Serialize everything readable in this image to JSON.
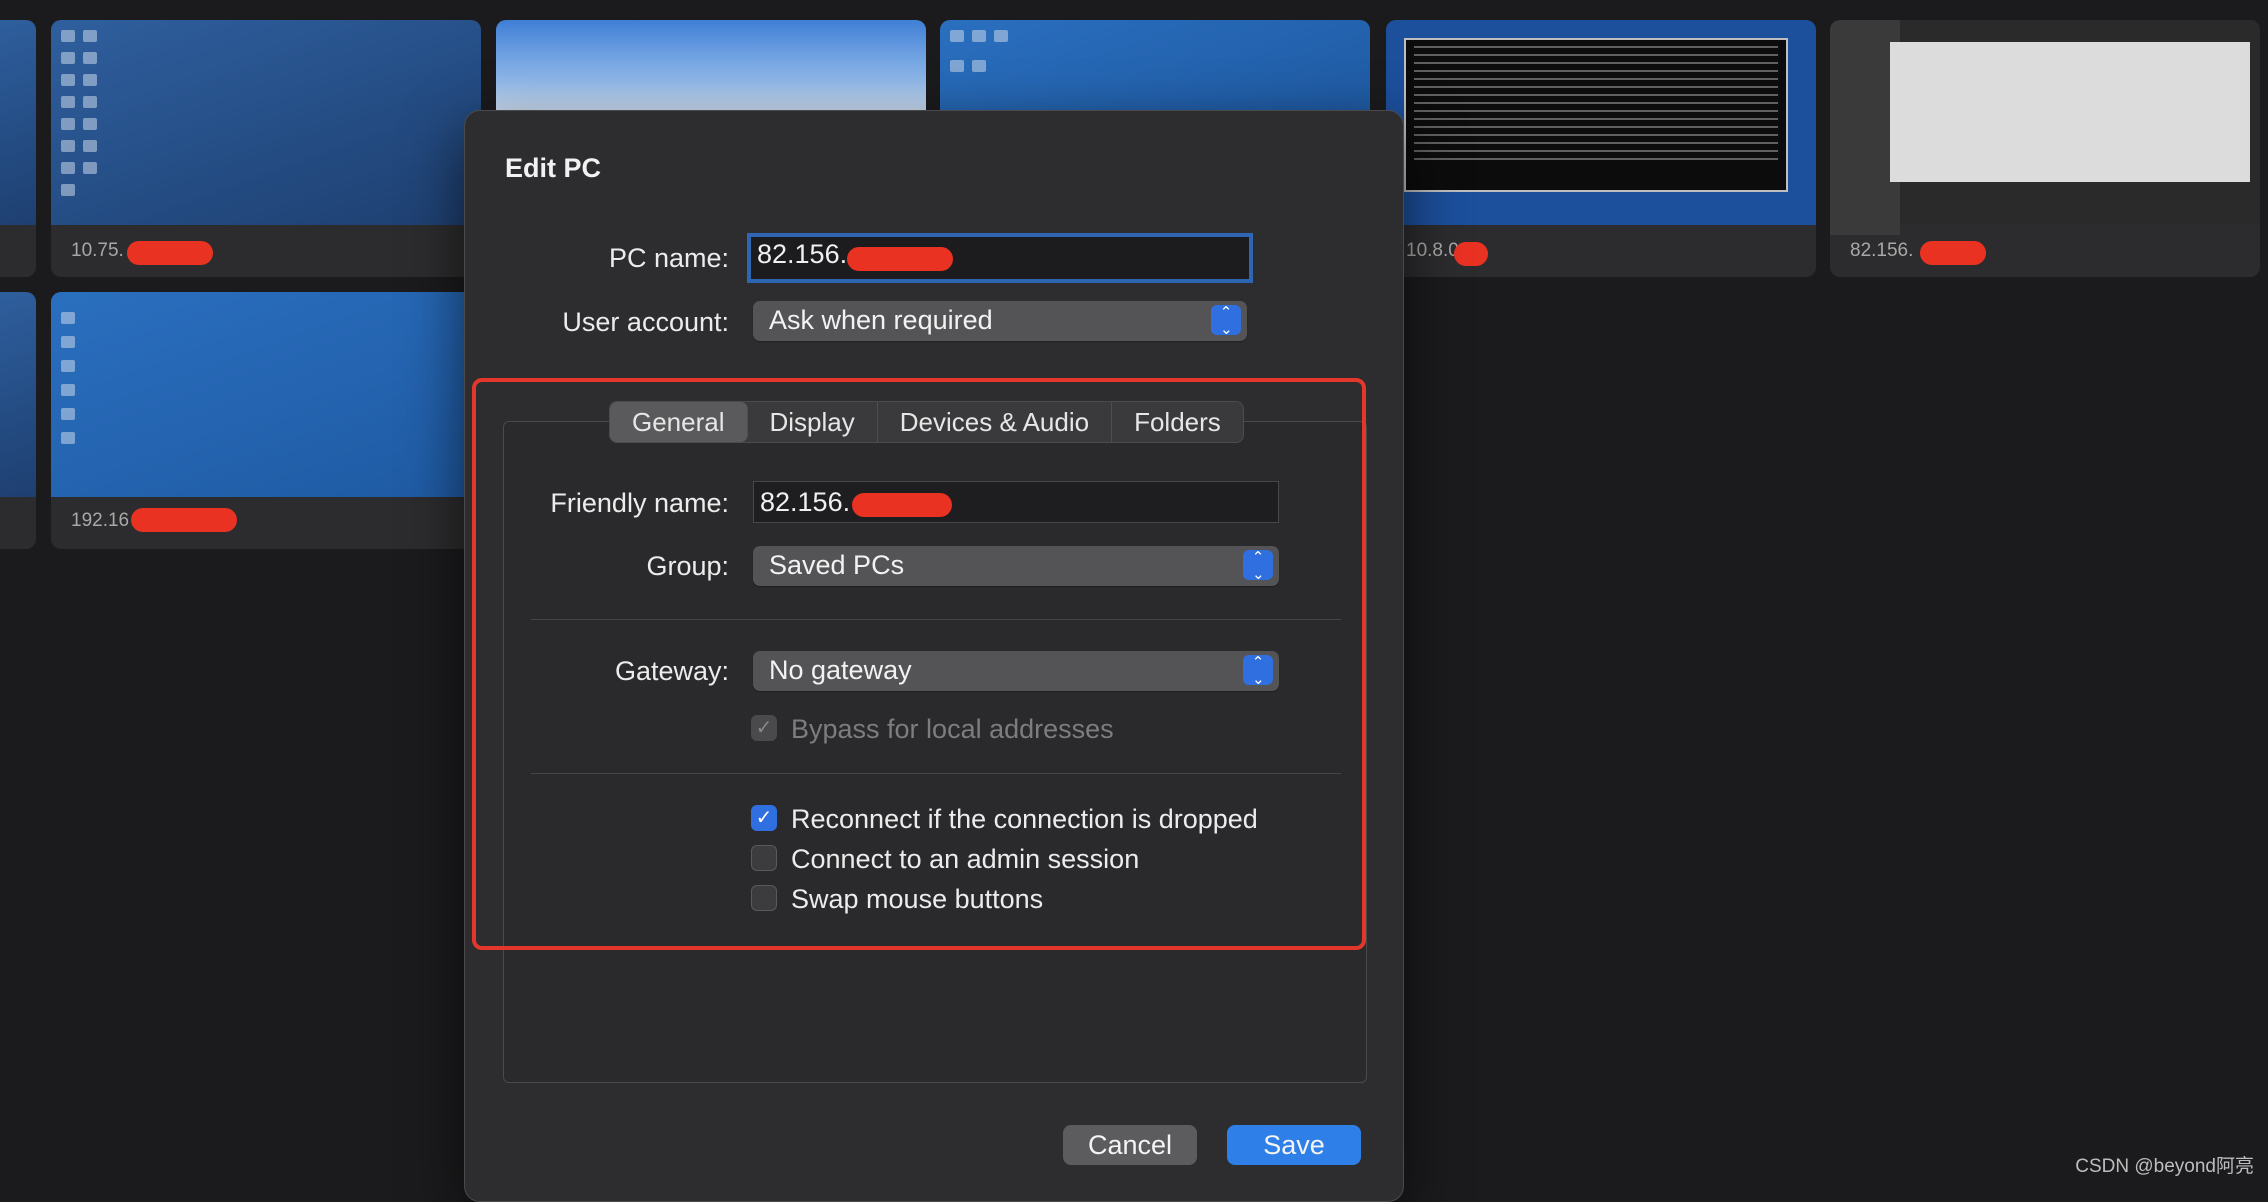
{
  "background_tiles": [
    {
      "label": "10.75."
    },
    {
      "label": "192.16"
    },
    {
      "label": "10.8.0"
    },
    {
      "label": "82.156."
    }
  ],
  "dialog": {
    "title": "Edit PC",
    "pc_name_label": "PC name:",
    "pc_name_value": "82.156.",
    "user_account_label": "User account:",
    "user_account_value": "Ask when required",
    "tabs": [
      {
        "label": "General",
        "selected": true
      },
      {
        "label": "Display",
        "selected": false
      },
      {
        "label": "Devices & Audio",
        "selected": false
      },
      {
        "label": "Folders",
        "selected": false
      }
    ],
    "friendly_name_label": "Friendly name:",
    "friendly_name_value": "82.156.",
    "group_label": "Group:",
    "group_value": "Saved PCs",
    "gateway_label": "Gateway:",
    "gateway_value": "No gateway",
    "bypass_label": "Bypass for local addresses",
    "reconnect_label": "Reconnect if the connection is dropped",
    "admin_label": "Connect to an admin session",
    "swap_label": "Swap mouse buttons",
    "checkbox_states": {
      "bypass": true,
      "reconnect": true,
      "admin": false,
      "swap": false
    },
    "cancel_label": "Cancel",
    "save_label": "Save"
  },
  "watermark": "CSDN @beyond阿亮",
  "colors": {
    "accent": "#2f7fe8",
    "highlight_box": "#e2372a",
    "redaction": "#ea3223"
  }
}
